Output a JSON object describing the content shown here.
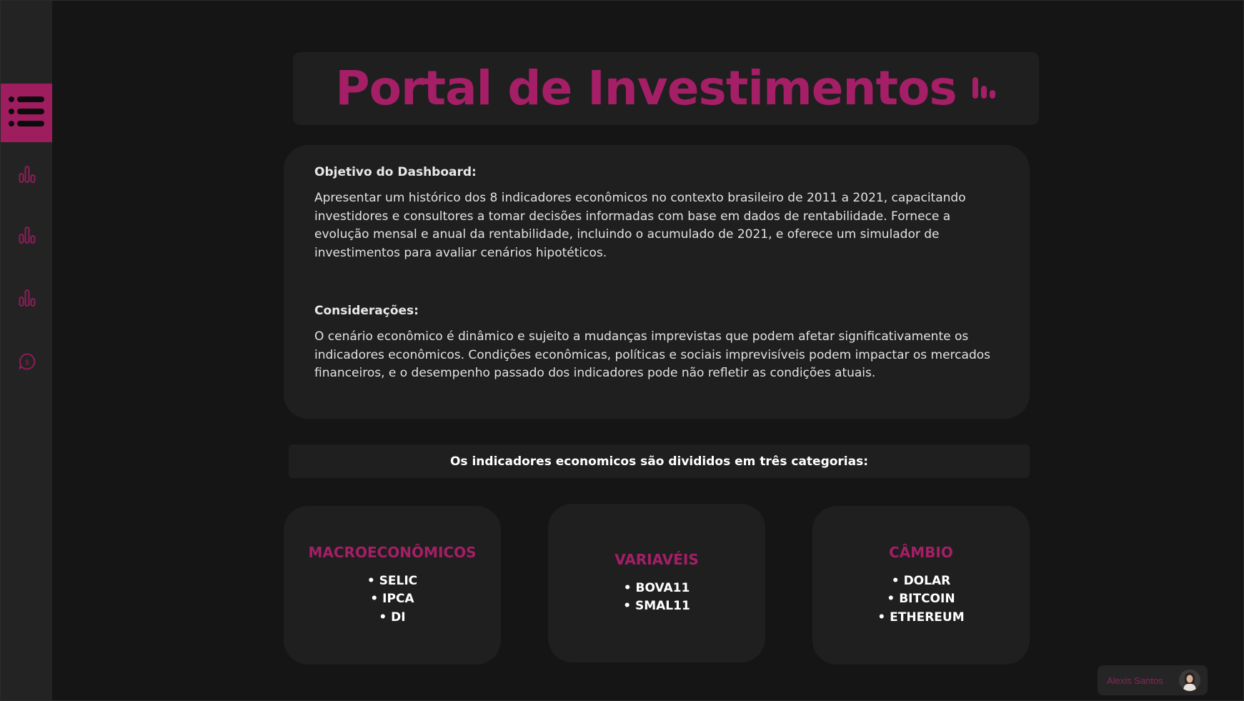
{
  "colors": {
    "accent": "#a41f66",
    "background": "#151515",
    "card": "#1f1f1f",
    "sidebar": "#232323"
  },
  "sidebar": {
    "menu_icon": "list-icon",
    "items": [
      {
        "icon": "bar-chart-icon"
      },
      {
        "icon": "bar-chart-icon"
      },
      {
        "icon": "bar-chart-icon"
      },
      {
        "icon": "chat-dollar-icon"
      }
    ]
  },
  "header": {
    "title": "Portal de Investimentos",
    "icon": "bar-chart-icon"
  },
  "info": {
    "objective_heading": "Objetivo do Dashboard:",
    "objective_text": "Apresentar um histórico dos 8 indicadores econômicos no contexto brasileiro de 2011 a 2021, capacitando investidores e consultores a tomar decisões informadas com base em dados de rentabilidade. Fornece a evolução mensal e anual da rentabilidade, incluindo o acumulado de 2021, e oferece um simulador de investimentos para avaliar cenários hipotéticos.",
    "considerations_heading": "Considerações:",
    "considerations_text": "O cenário econômico é dinâmico e sujeito a mudanças imprevistas que podem afetar significativamente os indicadores econômicos. Condições econômicas, políticas e sociais imprevisíveis podem impactar os mercados financeiros, e o desempenho passado dos indicadores pode não refletir as condições atuais."
  },
  "categories_banner": "Os indicadores economicos são divididos em três categorias:",
  "categories": [
    {
      "title": "MACROECONÔMICOS",
      "items": [
        "• SELIC",
        "• IPCA",
        "• DI"
      ]
    },
    {
      "title": "VARIAVÉIS",
      "items": [
        "• BOVA11",
        "• SMAL11"
      ]
    },
    {
      "title": "CÂMBIO",
      "items": [
        "• DOLAR",
        "• BITCOIN",
        "• ETHEREUM"
      ]
    }
  ],
  "user": {
    "name": "Alexis Santos",
    "avatar_icon": "user-avatar"
  }
}
